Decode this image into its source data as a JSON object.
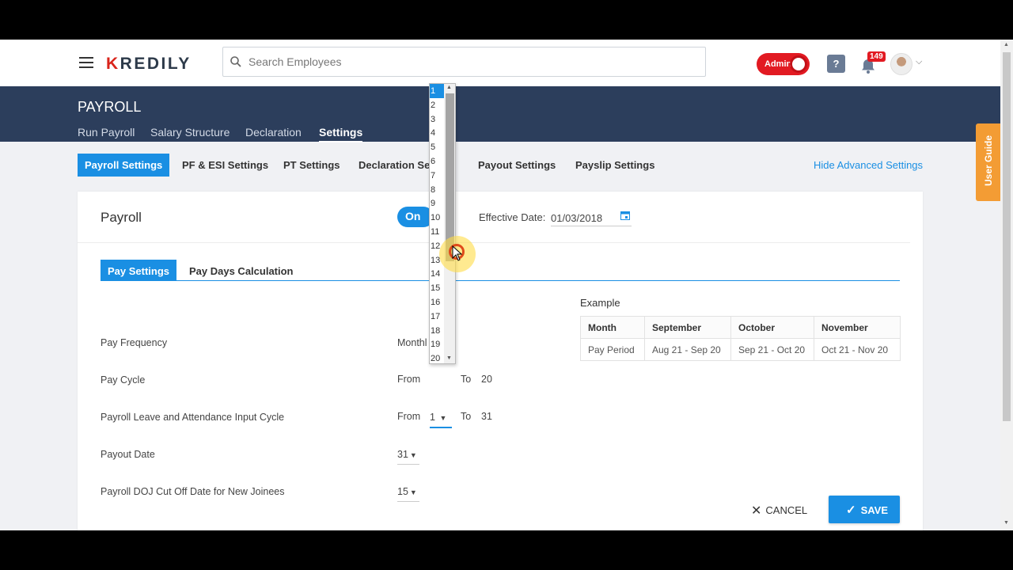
{
  "app": {
    "logo": "KREDILY",
    "logo_first": "K",
    "logo_rest": "REDILY"
  },
  "topbar": {
    "search_placeholder": "Search Employees",
    "admin_label": "Admin",
    "help_label": "?",
    "notification_count": "149"
  },
  "header": {
    "title": "PAYROLL",
    "tabs": [
      {
        "label": "Run Payroll",
        "active": false
      },
      {
        "label": "Salary Structure",
        "active": false
      },
      {
        "label": "Declaration",
        "active": false
      },
      {
        "label": "Settings",
        "active": true
      }
    ]
  },
  "subtabs": [
    {
      "label": "Payroll Settings",
      "active": true
    },
    {
      "label": "PF & ESI Settings",
      "active": false
    },
    {
      "label": "PT Settings",
      "active": false
    },
    {
      "label": "Declaration Se",
      "active": false
    },
    {
      "label": "Payout Settings",
      "active": false
    },
    {
      "label": "Payslip Settings",
      "active": false
    }
  ],
  "advanced_link": "Hide Advanced Settings",
  "card": {
    "heading": "Payroll",
    "toggle_label": "On",
    "effective_date_label": "Effective Date:",
    "effective_date_value": "01/03/2018",
    "inner_tabs": [
      {
        "label": "Pay Settings",
        "active": true
      },
      {
        "label": "Pay Days Calculation",
        "active": false
      }
    ]
  },
  "settings": {
    "pay_frequency": {
      "label": "Pay Frequency",
      "value": "Monthl"
    },
    "pay_cycle": {
      "label": "Pay Cycle",
      "from_label": "From",
      "to_label": "To",
      "to_value": "20"
    },
    "leave_cycle": {
      "label": "Payroll Leave and Attendance Input Cycle",
      "from_label": "From",
      "from_value": "1",
      "to_label": "To",
      "to_value": "31"
    },
    "payout_date": {
      "label": "Payout Date",
      "value": "31"
    },
    "doj_cutoff": {
      "label": "Payroll DOJ Cut Off Date for New Joinees",
      "value": "15"
    }
  },
  "example": {
    "title": "Example",
    "headers": [
      "Month",
      "September",
      "October",
      "November"
    ],
    "row_label": "Pay Period",
    "row_values": [
      "Aug 21 - Sep 20",
      "Sep 21 - Oct 20",
      "Oct 21 - Nov 20"
    ]
  },
  "actions": {
    "cancel_label": "CANCEL",
    "save_label": "SAVE"
  },
  "user_guide_label": "User Guide",
  "dropdown": {
    "selected": "1",
    "options": [
      "1",
      "2",
      "3",
      "4",
      "5",
      "6",
      "7",
      "8",
      "9",
      "10",
      "11",
      "12",
      "13",
      "14",
      "15",
      "16",
      "17",
      "18",
      "19",
      "20"
    ]
  },
  "colors": {
    "accent": "#1a8fe3",
    "header_bg": "#2c3e5c",
    "admin_red": "#e21a22",
    "user_guide": "#f39c34"
  },
  "icons": [
    "menu-icon",
    "search-icon",
    "question-icon",
    "bell-icon",
    "calendar-icon",
    "close-icon",
    "check-icon",
    "chevron-down-icon"
  ]
}
